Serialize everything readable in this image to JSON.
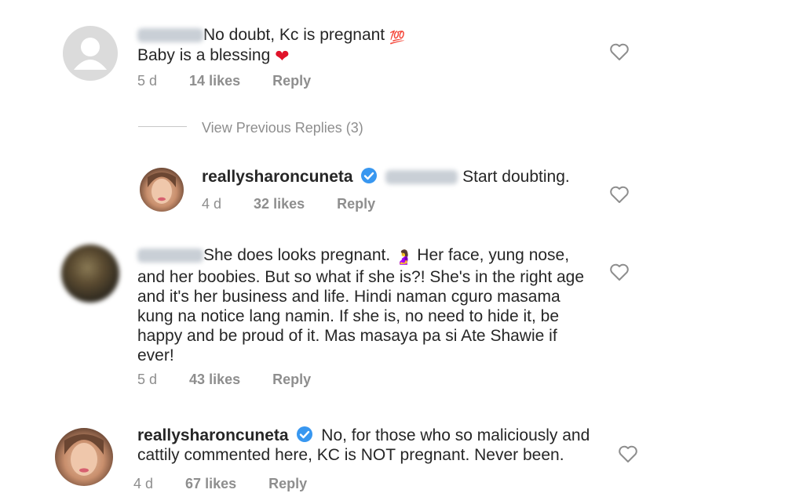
{
  "comments": [
    {
      "text_line1": "No doubt, Kc is pregnant",
      "emoji1": "💯",
      "text_line2": "Baby is a blessing",
      "emoji2": "❤",
      "age": "5 d",
      "likes": "14 likes",
      "reply": "Reply"
    },
    {
      "username": "reallysharoncuneta",
      "text": "Start doubting.",
      "age": "4 d",
      "likes": "32 likes",
      "reply": "Reply"
    },
    {
      "lines": [
        "She does looks pregnant.",
        "and her boobies. But so what if she is?! She's in the right age",
        "and it's her business and life. Hindi naman cguro masama",
        "kung na notice lang namin. If she is, no need to hide it, be",
        "happy and be proud of it.  Mas masaya pa si Ate Shawie if",
        "ever!"
      ],
      "line1_emoji": "🤰",
      "line1_tail": "Her face, yung nose,",
      "age": "5 d",
      "likes": "43 likes",
      "reply": "Reply"
    },
    {
      "username": "reallysharoncuneta",
      "line1": "No, for those who so maliciously and",
      "line2": "cattily commented here, KC is NOT pregnant. Never been.",
      "age": "4 d",
      "likes": "67 likes",
      "reply": "Reply"
    }
  ],
  "view_replies": "View Previous Replies (3)",
  "colors": {
    "text": "#262626",
    "meta": "#8e8e8e",
    "verified": "#3897f0",
    "heart_stroke": "#8e8e8e"
  }
}
